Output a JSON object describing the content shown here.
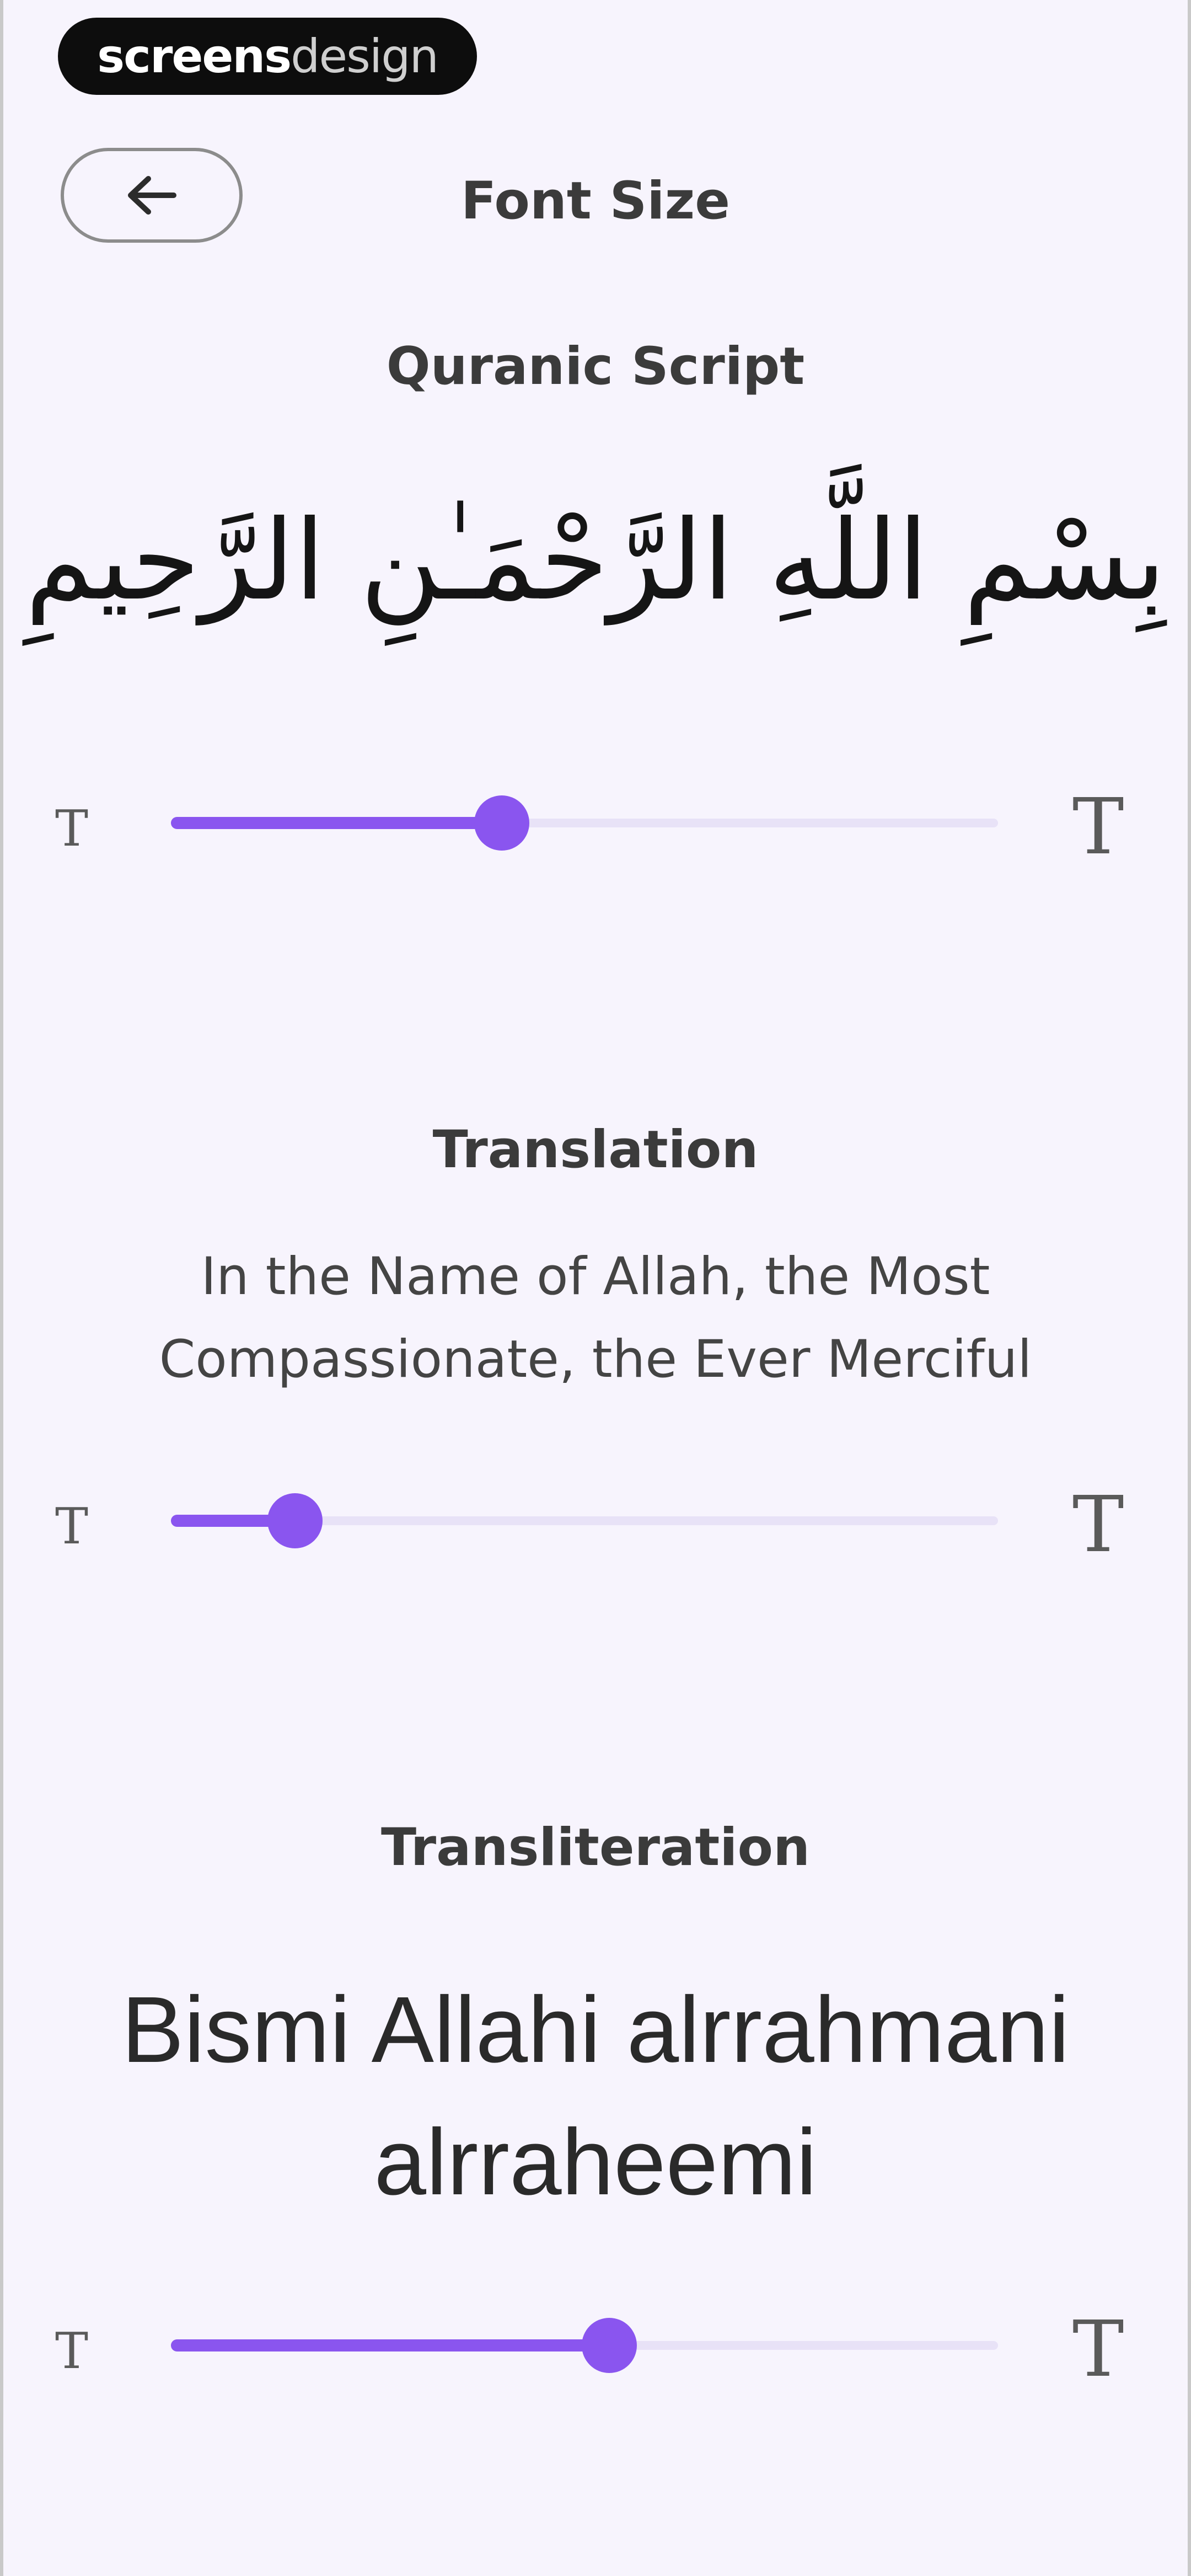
{
  "brand": {
    "part1": "screens",
    "part2": "design"
  },
  "header": {
    "title": "Font Size"
  },
  "colors": {
    "accent": "#8a55ef",
    "track": "#e8e2f7",
    "background": "#f7f4fd"
  },
  "icons": {
    "back": "arrow-left-icon",
    "small_text": "text-size-small-icon",
    "large_text": "text-size-large-icon"
  },
  "sections": [
    {
      "title": "Quranic Script",
      "preview": "بِسْمِ اللَّهِ الرَّحْمَـٰنِ الرَّحِيمِ",
      "slider": {
        "small_glyph": "T",
        "large_glyph": "T",
        "value": 0.4
      }
    },
    {
      "title": "Translation",
      "preview": "In the Name of Allah, the Most Compassionate, the Ever Merciful",
      "slider": {
        "small_glyph": "T",
        "large_glyph": "T",
        "value": 0.15
      }
    },
    {
      "title": "Transliteration",
      "preview_line1": "Bismi Allahi alrrahmani",
      "preview_line2": "alrraheemi",
      "slider": {
        "small_glyph": "T",
        "large_glyph": "T",
        "value": 0.53
      }
    }
  ]
}
